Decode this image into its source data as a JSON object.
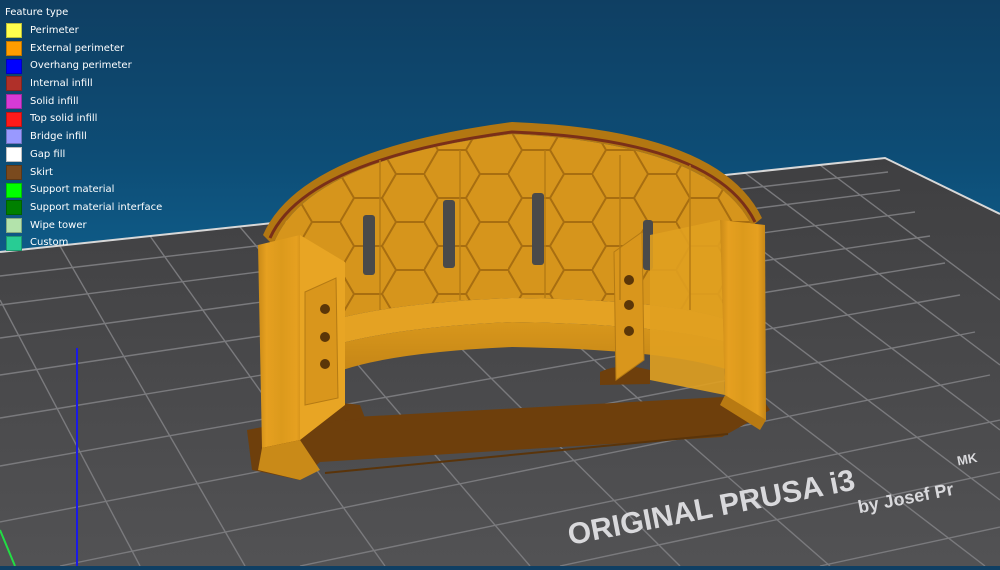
{
  "legend": {
    "title": "Feature type",
    "items": [
      {
        "label": "Perimeter",
        "color": "#ffff4d"
      },
      {
        "label": "External perimeter",
        "color": "#ff9d00"
      },
      {
        "label": "Overhang perimeter",
        "color": "#0000ff"
      },
      {
        "label": "Internal infill",
        "color": "#b03029"
      },
      {
        "label": "Solid infill",
        "color": "#d63ad6"
      },
      {
        "label": "Top solid infill",
        "color": "#ff1a1a"
      },
      {
        "label": "Bridge infill",
        "color": "#9999ff"
      },
      {
        "label": "Gap fill",
        "color": "#ffffff"
      },
      {
        "label": "Skirt",
        "color": "#7a4a1e"
      },
      {
        "label": "Support material",
        "color": "#00ff00"
      },
      {
        "label": "Support material interface",
        "color": "#008000"
      },
      {
        "label": "Wipe tower",
        "color": "#b3e3ab"
      },
      {
        "label": "Custom",
        "color": "#28cc94"
      }
    ]
  },
  "bed": {
    "brand_line1": "ORIGINAL PRUSA i3",
    "brand_model": "MK",
    "brand_line2": "by Josef Pr"
  },
  "colors": {
    "bed_surface": "#4a4a4a",
    "grid_line": "#8a8a8a",
    "model_orange": "#e19a1c",
    "skirt_brown": "#6e3f0c",
    "z_axis": "#1a1ae6",
    "x_axis_hint": "#22dd44"
  }
}
